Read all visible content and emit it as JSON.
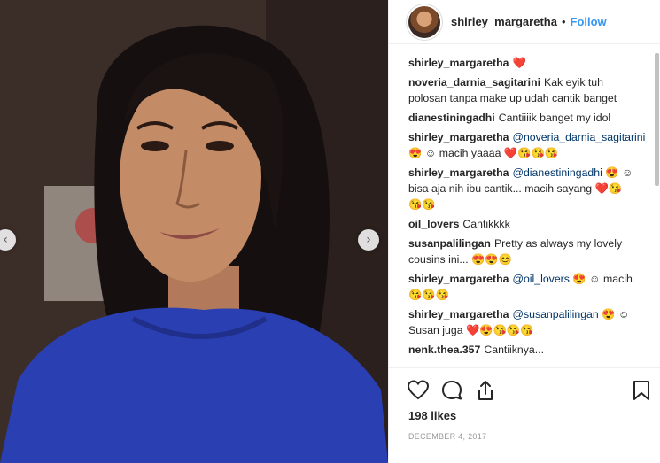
{
  "post": {
    "username": "shirley_margaretha",
    "separator": "•",
    "follow_label": "Follow",
    "likes_label": "198 likes",
    "date_label": "DECEMBER 4, 2017"
  },
  "comments": [
    {
      "user": "shirley_margaretha",
      "text": "❤️"
    },
    {
      "user": "noveria_darnia_sagitarini",
      "text": "Kak eyik tuh polosan tanpa make up udah cantik banget"
    },
    {
      "user": "dianestiningadhi",
      "text": "Cantiiiik banget my idol"
    },
    {
      "user": "shirley_margaretha",
      "mention": "@noveria_darnia_sagitarini",
      "text": "😍 ☺ macih yaaaa ❤️😘😘😘"
    },
    {
      "user": "shirley_margaretha",
      "mention": "@dianestiningadhi",
      "text": "😍 ☺ bisa aja nih ibu cantik... macih sayang ❤️😘😘😘"
    },
    {
      "user": "oil_lovers",
      "text": "Cantikkkk"
    },
    {
      "user": "susanpalilingan",
      "text": "Pretty as always my lovely cousins ini... 😍😍😊"
    },
    {
      "user": "shirley_margaretha",
      "mention": "@oil_lovers",
      "text": "😍 ☺ macih 😘😘😘"
    },
    {
      "user": "shirley_margaretha",
      "mention": "@susanpalilingan",
      "text": "😍 ☺ Susan juga ❤️😍😘😘😘"
    },
    {
      "user": "nenk.thea.357",
      "text": "Cantiiknya..."
    }
  ],
  "icons": {
    "like": "heart-icon",
    "comment": "comment-icon",
    "share": "share-icon",
    "save": "bookmark-icon",
    "prev": "chevron-left-icon",
    "next": "chevron-right-icon"
  },
  "nav": {
    "prev_glyph": "‹",
    "next_glyph": "›"
  },
  "colors": {
    "accent": "#3897f0",
    "text": "#262626",
    "muted": "#999999",
    "border": "#efefef",
    "heart": "#ed4956"
  }
}
